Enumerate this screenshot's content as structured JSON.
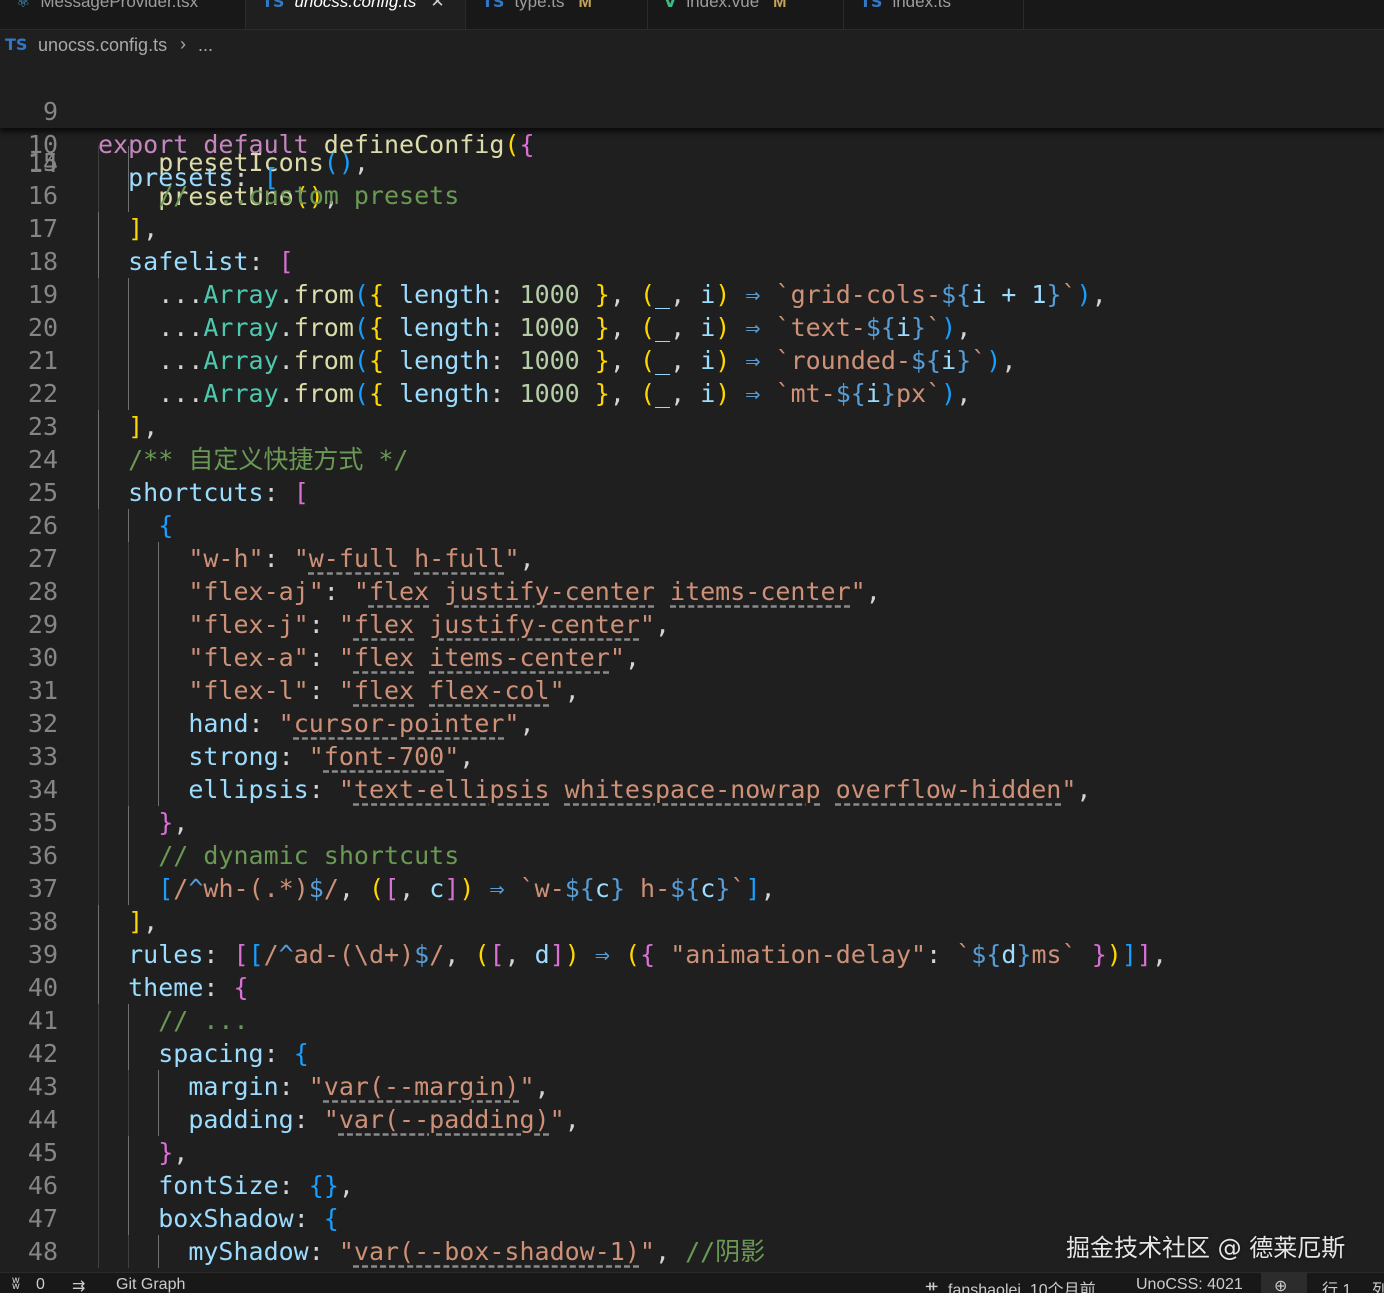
{
  "tabs": [
    {
      "label": "MessageProvider.tsx",
      "icon": "react-icon",
      "active": false,
      "modified": ""
    },
    {
      "label": "unocss.config.ts",
      "icon": "ts-icon",
      "active": true,
      "modified": ""
    },
    {
      "label": "type.ts",
      "icon": "ts-icon",
      "active": false,
      "modified": "M"
    },
    {
      "label": "index.vue",
      "icon": "vue-icon",
      "active": false,
      "modified": "M"
    },
    {
      "label": "index.ts",
      "icon": "ts-icon",
      "active": false,
      "modified": ""
    }
  ],
  "icons": {
    "ts": "TS",
    "vue": "V",
    "react": "⚛",
    "close": "✕",
    "chevron": "›"
  },
  "breadcrumb": {
    "file": "unocss.config.ts",
    "more": "..."
  },
  "editor": {
    "sticky_lines": [
      {
        "num": "9",
        "text": "export default defineConfig({"
      },
      {
        "num": "10",
        "text": "presets: ["
      }
    ],
    "partial_line": {
      "num": "14",
      "text": "presetUno(),"
    },
    "lines": [
      {
        "num": "15",
        "text": "presetIcons(),"
      },
      {
        "num": "16",
        "text": "// ...custom presets"
      },
      {
        "num": "17",
        "text": "],"
      },
      {
        "num": "18",
        "text": "safelist: ["
      },
      {
        "num": "19",
        "text": "...Array.from({ length: 1000 }, (_, i) ⇒ `grid-cols-${i + 1}`),"
      },
      {
        "num": "20",
        "text": "...Array.from({ length: 1000 }, (_, i) ⇒ `text-${i}`),"
      },
      {
        "num": "21",
        "text": "...Array.from({ length: 1000 }, (_, i) ⇒ `rounded-${i}`),"
      },
      {
        "num": "22",
        "text": "...Array.from({ length: 1000 }, (_, i) ⇒ `mt-${i}px`),"
      },
      {
        "num": "23",
        "text": "],"
      },
      {
        "num": "24",
        "text": "/** 自定义快捷方式 */"
      },
      {
        "num": "25",
        "text": "shortcuts: ["
      },
      {
        "num": "26",
        "text": "{"
      },
      {
        "num": "27",
        "text": "\"w-h\": \"w-full h-full\","
      },
      {
        "num": "28",
        "text": "\"flex-aj\": \"flex justify-center items-center\","
      },
      {
        "num": "29",
        "text": "\"flex-j\": \"flex justify-center\","
      },
      {
        "num": "30",
        "text": "\"flex-a\": \"flex items-center\","
      },
      {
        "num": "31",
        "text": "\"flex-l\": \"flex flex-col\","
      },
      {
        "num": "32",
        "text": "hand: \"cursor-pointer\","
      },
      {
        "num": "33",
        "text": "strong: \"font-700\","
      },
      {
        "num": "34",
        "text": "ellipsis: \"text-ellipsis whitespace-nowrap overflow-hidden\","
      },
      {
        "num": "35",
        "text": "},"
      },
      {
        "num": "36",
        "text": "// dynamic shortcuts"
      },
      {
        "num": "37",
        "text": "[/^wh-(.*)$/, ([, c]) ⇒ `w-${c} h-${c}`],"
      },
      {
        "num": "38",
        "text": "],"
      },
      {
        "num": "39",
        "text": "rules: [[/^ad-(\\d+)$/, ([, d]) ⇒ ({ \"animation-delay\": `${d}ms` })]],"
      },
      {
        "num": "40",
        "text": "theme: {"
      },
      {
        "num": "41",
        "text": "// ..."
      },
      {
        "num": "42",
        "text": "spacing: {"
      },
      {
        "num": "43",
        "text": "margin: \"var(--margin)\","
      },
      {
        "num": "44",
        "text": "padding: \"var(--padding)\","
      },
      {
        "num": "45",
        "text": "},"
      },
      {
        "num": "46",
        "text": "fontSize: {},"
      },
      {
        "num": "47",
        "text": "boxShadow: {"
      },
      {
        "num": "48",
        "text": "myShadow: \"var(--box-shadow-1)\", //阴影"
      }
    ]
  },
  "statusbar": {
    "sync_icon": "ʬ",
    "problems": "0",
    "graph_icon": "⇉",
    "git_graph": "Git Graph",
    "blame": "fanshaolei, 10个月前",
    "unocss": "UnoCSS: 4021",
    "zoom_icon": "⊕",
    "position": "行 1",
    "col": "列"
  },
  "watermark": "掘金技术社区 @ 德莱厄斯",
  "colors": {
    "background": "#1f1f1f",
    "keyword": "#c586c0",
    "function": "#dcdcaa",
    "property": "#9cdcfe",
    "string": "#ce9178",
    "number": "#b5cea8",
    "comment": "#6a9955",
    "class": "#4ec9b0",
    "bracket_gold": "#ffd700",
    "bracket_violet": "#da70d6",
    "bracket_blue": "#179fff"
  }
}
